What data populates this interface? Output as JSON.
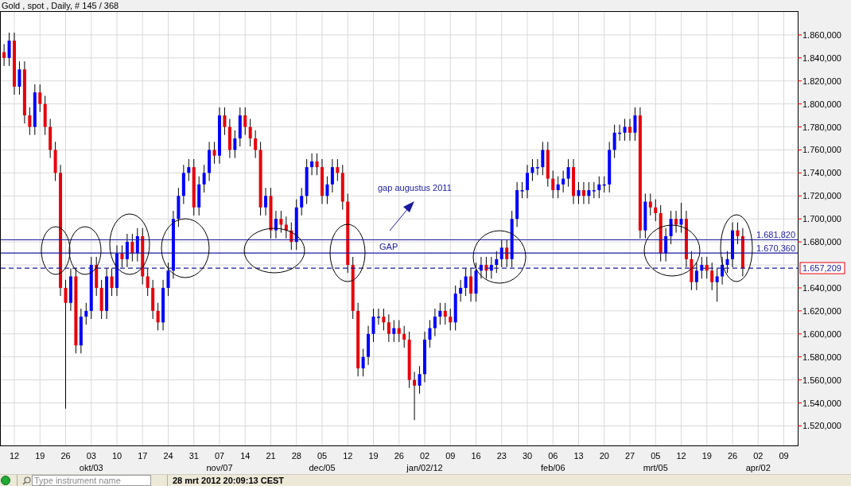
{
  "chart_title": "Gold , spot , Daily, # 145 / 368",
  "chart": {
    "chart_data": {
      "type": "candlestick",
      "categories": [
        null,
        null,
        "12",
        null,
        null,
        null,
        null,
        "19",
        null,
        null,
        null,
        null,
        "26",
        null,
        null,
        null,
        null,
        "03",
        null,
        null,
        null,
        null,
        "10",
        null,
        null,
        null,
        null,
        "17",
        null,
        null,
        null,
        null,
        "24",
        null,
        null,
        null,
        null,
        "31",
        null,
        null,
        null,
        null,
        "07",
        null,
        null,
        null,
        null,
        "14",
        null,
        null,
        null,
        null,
        "21",
        null,
        null,
        null,
        null,
        "28",
        null,
        null,
        null,
        null,
        "05",
        null,
        null,
        null,
        null,
        "12",
        null,
        null,
        null,
        null,
        "19",
        null,
        null,
        null,
        null,
        "26",
        null,
        null,
        null,
        null,
        "02",
        null,
        null,
        null,
        null,
        "09",
        null,
        null,
        null,
        null,
        "16",
        null,
        null,
        null,
        null,
        "23",
        null,
        null,
        null,
        null,
        "30",
        null,
        null,
        null,
        null,
        "06",
        null,
        null,
        null,
        null,
        "13",
        null,
        null,
        null,
        null,
        "20",
        null,
        null,
        null,
        null,
        "27",
        null,
        null,
        null,
        null,
        "05",
        null,
        null,
        null,
        null,
        "12",
        null,
        null,
        null,
        null,
        "19",
        null,
        null,
        null,
        null,
        "26",
        null,
        null,
        null,
        null,
        "02",
        null,
        null,
        null,
        null,
        "09",
        null,
        null
      ],
      "ohlc": [
        [
          1845,
          1852,
          1833,
          1840
        ],
        [
          1840,
          1862,
          1833,
          1855
        ],
        [
          1855,
          1862,
          1808,
          1815
        ],
        [
          1815,
          1837,
          1808,
          1830
        ],
        [
          1830,
          1837,
          1783,
          1790
        ],
        [
          1790,
          1797,
          1773,
          1780
        ],
        [
          1780,
          1817,
          1773,
          1810
        ],
        [
          1810,
          1817,
          1793,
          1800
        ],
        [
          1800,
          1807,
          1773,
          1780
        ],
        [
          1780,
          1787,
          1753,
          1760
        ],
        [
          1760,
          1767,
          1733,
          1740
        ],
        [
          1740,
          1747,
          1633,
          1640
        ],
        [
          1640,
          1647,
          1535,
          1627
        ],
        [
          1627,
          1657,
          1620,
          1650
        ],
        [
          1650,
          1657,
          1583,
          1590
        ],
        [
          1590,
          1622,
          1583,
          1615
        ],
        [
          1615,
          1627,
          1608,
          1620
        ],
        [
          1620,
          1667,
          1613,
          1660
        ],
        [
          1660,
          1667,
          1633,
          1640
        ],
        [
          1640,
          1647,
          1613,
          1620
        ],
        [
          1620,
          1657,
          1613,
          1650
        ],
        [
          1650,
          1657,
          1633,
          1640
        ],
        [
          1640,
          1677,
          1633,
          1670
        ],
        [
          1670,
          1677,
          1658,
          1665
        ],
        [
          1665,
          1687,
          1658,
          1680
        ],
        [
          1680,
          1687,
          1663,
          1670
        ],
        [
          1670,
          1692,
          1663,
          1685
        ],
        [
          1685,
          1692,
          1643,
          1650
        ],
        [
          1650,
          1657,
          1633,
          1640
        ],
        [
          1640,
          1647,
          1613,
          1620
        ],
        [
          1620,
          1627,
          1603,
          1610
        ],
        [
          1610,
          1647,
          1603,
          1640
        ],
        [
          1640,
          1662,
          1633,
          1655
        ],
        [
          1655,
          1707,
          1648,
          1700
        ],
        [
          1700,
          1727,
          1693,
          1720
        ],
        [
          1720,
          1747,
          1713,
          1740
        ],
        [
          1740,
          1752,
          1733,
          1745
        ],
        [
          1745,
          1752,
          1703,
          1710
        ],
        [
          1710,
          1737,
          1703,
          1730
        ],
        [
          1730,
          1747,
          1723,
          1740
        ],
        [
          1740,
          1767,
          1733,
          1760
        ],
        [
          1760,
          1767,
          1748,
          1755
        ],
        [
          1755,
          1797,
          1748,
          1790
        ],
        [
          1790,
          1797,
          1773,
          1780
        ],
        [
          1780,
          1787,
          1753,
          1760
        ],
        [
          1760,
          1777,
          1753,
          1770
        ],
        [
          1770,
          1797,
          1763,
          1790
        ],
        [
          1790,
          1797,
          1773,
          1780
        ],
        [
          1780,
          1787,
          1763,
          1770
        ],
        [
          1770,
          1777,
          1753,
          1760
        ],
        [
          1760,
          1767,
          1703,
          1710
        ],
        [
          1710,
          1727,
          1703,
          1720
        ],
        [
          1720,
          1727,
          1683,
          1690
        ],
        [
          1690,
          1707,
          1683,
          1700
        ],
        [
          1700,
          1707,
          1688,
          1695
        ],
        [
          1695,
          1702,
          1683,
          1690
        ],
        [
          1690,
          1697,
          1673,
          1680
        ],
        [
          1680,
          1717,
          1673,
          1710
        ],
        [
          1710,
          1727,
          1703,
          1720
        ],
        [
          1720,
          1752,
          1713,
          1745
        ],
        [
          1745,
          1757,
          1738,
          1750
        ],
        [
          1750,
          1757,
          1738,
          1745
        ],
        [
          1745,
          1752,
          1713,
          1720
        ],
        [
          1720,
          1737,
          1713,
          1730
        ],
        [
          1730,
          1752,
          1723,
          1745
        ],
        [
          1745,
          1752,
          1733,
          1740
        ],
        [
          1740,
          1747,
          1708,
          1715
        ],
        [
          1715,
          1722,
          1653,
          1660
        ],
        [
          1660,
          1667,
          1613,
          1620
        ],
        [
          1620,
          1627,
          1563,
          1570
        ],
        [
          1570,
          1587,
          1563,
          1580
        ],
        [
          1580,
          1607,
          1573,
          1600
        ],
        [
          1600,
          1622,
          1593,
          1615
        ],
        [
          1615,
          1622,
          1608,
          1615
        ],
        [
          1615,
          1622,
          1603,
          1610
        ],
        [
          1610,
          1617,
          1593,
          1600
        ],
        [
          1600,
          1612,
          1593,
          1605
        ],
        [
          1605,
          1612,
          1593,
          1600
        ],
        [
          1600,
          1607,
          1588,
          1595
        ],
        [
          1595,
          1602,
          1553,
          1560
        ],
        [
          1560,
          1567,
          1525,
          1555
        ],
        [
          1555,
          1572,
          1548,
          1565
        ],
        [
          1565,
          1602,
          1558,
          1595
        ],
        [
          1595,
          1612,
          1588,
          1605
        ],
        [
          1605,
          1622,
          1598,
          1615
        ],
        [
          1615,
          1627,
          1608,
          1620
        ],
        [
          1620,
          1627,
          1608,
          1615
        ],
        [
          1615,
          1622,
          1603,
          1610
        ],
        [
          1610,
          1642,
          1603,
          1635
        ],
        [
          1635,
          1647,
          1628,
          1640
        ],
        [
          1640,
          1657,
          1633,
          1650
        ],
        [
          1650,
          1657,
          1628,
          1635
        ],
        [
          1635,
          1662,
          1628,
          1655
        ],
        [
          1655,
          1667,
          1648,
          1660
        ],
        [
          1660,
          1667,
          1648,
          1655
        ],
        [
          1655,
          1667,
          1648,
          1660
        ],
        [
          1660,
          1672,
          1653,
          1665
        ],
        [
          1665,
          1682,
          1658,
          1675
        ],
        [
          1675,
          1682,
          1658,
          1665
        ],
        [
          1665,
          1707,
          1658,
          1700
        ],
        [
          1700,
          1732,
          1693,
          1725
        ],
        [
          1725,
          1732,
          1718,
          1725
        ],
        [
          1725,
          1747,
          1718,
          1740
        ],
        [
          1740,
          1752,
          1733,
          1745
        ],
        [
          1745,
          1752,
          1738,
          1745
        ],
        [
          1745,
          1767,
          1738,
          1760
        ],
        [
          1760,
          1767,
          1728,
          1735
        ],
        [
          1735,
          1742,
          1718,
          1725
        ],
        [
          1725,
          1737,
          1718,
          1730
        ],
        [
          1730,
          1742,
          1723,
          1735
        ],
        [
          1735,
          1752,
          1728,
          1745
        ],
        [
          1745,
          1752,
          1713,
          1720
        ],
        [
          1720,
          1732,
          1713,
          1725
        ],
        [
          1725,
          1732,
          1713,
          1720
        ],
        [
          1720,
          1732,
          1713,
          1725
        ],
        [
          1725,
          1732,
          1718,
          1725
        ],
        [
          1725,
          1737,
          1718,
          1730
        ],
        [
          1730,
          1737,
          1723,
          1730
        ],
        [
          1730,
          1767,
          1723,
          1760
        ],
        [
          1760,
          1782,
          1753,
          1775
        ],
        [
          1775,
          1782,
          1768,
          1775
        ],
        [
          1775,
          1787,
          1768,
          1780
        ],
        [
          1780,
          1787,
          1768,
          1775
        ],
        [
          1775,
          1797,
          1768,
          1790
        ],
        [
          1790,
          1797,
          1683,
          1690
        ],
        [
          1690,
          1722,
          1683,
          1715
        ],
        [
          1715,
          1722,
          1703,
          1710
        ],
        [
          1710,
          1717,
          1698,
          1705
        ],
        [
          1705,
          1712,
          1663,
          1670
        ],
        [
          1670,
          1692,
          1663,
          1685
        ],
        [
          1685,
          1707,
          1678,
          1700
        ],
        [
          1700,
          1707,
          1688,
          1695
        ],
        [
          1695,
          1714,
          1688,
          1700
        ],
        [
          1700,
          1707,
          1658,
          1665
        ],
        [
          1665,
          1672,
          1638,
          1645
        ],
        [
          1645,
          1662,
          1638,
          1655
        ],
        [
          1655,
          1667,
          1648,
          1660
        ],
        [
          1660,
          1667,
          1648,
          1655
        ],
        [
          1655,
          1662,
          1638,
          1645
        ],
        [
          1645,
          1657,
          1628,
          1650
        ],
        [
          1650,
          1667,
          1643,
          1660
        ],
        [
          1660,
          1672,
          1653,
          1665
        ],
        [
          1665,
          1697,
          1658,
          1690
        ],
        [
          1690,
          1697,
          1678,
          1685
        ],
        [
          1685,
          1692,
          1650,
          1657
        ],
        null,
        null,
        null,
        null,
        null,
        null,
        null,
        null,
        null,
        null
      ],
      "ylim": [
        1503,
        1880
      ],
      "grid": true,
      "yticks": [
        {
          "value": 1520,
          "label": "1.520,000"
        },
        {
          "value": 1540,
          "label": "1.540,000"
        },
        {
          "value": 1560,
          "label": "1.560,000"
        },
        {
          "value": 1580,
          "label": "1.580,000"
        },
        {
          "value": 1600,
          "label": "1.600,000"
        },
        {
          "value": 1620,
          "label": "1.620,000"
        },
        {
          "value": 1640,
          "label": "1.640,000"
        },
        {
          "value": 1680,
          "label": "1.680,000"
        },
        {
          "value": 1700,
          "label": "1.700,000"
        },
        {
          "value": 1720,
          "label": "1.720,000"
        },
        {
          "value": 1740,
          "label": "1.740,000"
        },
        {
          "value": 1760,
          "label": "1.760,000"
        },
        {
          "value": 1780,
          "label": "1.780,000"
        },
        {
          "value": 1800,
          "label": "1.800,000"
        },
        {
          "value": 1820,
          "label": "1.820,000"
        },
        {
          "value": 1840,
          "label": "1.840,000"
        },
        {
          "value": 1860,
          "label": "1.860,000"
        }
      ],
      "ref_lines": [
        {
          "axis": "y",
          "value": 1681.82,
          "label": "1.681,820",
          "color": "#1a1aa0"
        },
        {
          "axis": "y",
          "value": 1670.36,
          "label": "1.670,360",
          "color": "#1a1aa0"
        },
        {
          "axis": "y",
          "value": 1657.209,
          "label": "1.657,209",
          "color": "#1a1aa0"
        }
      ],
      "annotations": [
        "GAP",
        "gap augustus 2011"
      ]
    },
    "month_labels": [
      "okt/03",
      "nov/07",
      "dec/05",
      "jan/02/12",
      "feb/06",
      "mrt/05",
      "apr/02"
    ]
  },
  "status_bar": {
    "search": {
      "placeholder": "Type instrument name"
    },
    "timestamp": "28 mrt 2012 20:09:13 CEST"
  }
}
